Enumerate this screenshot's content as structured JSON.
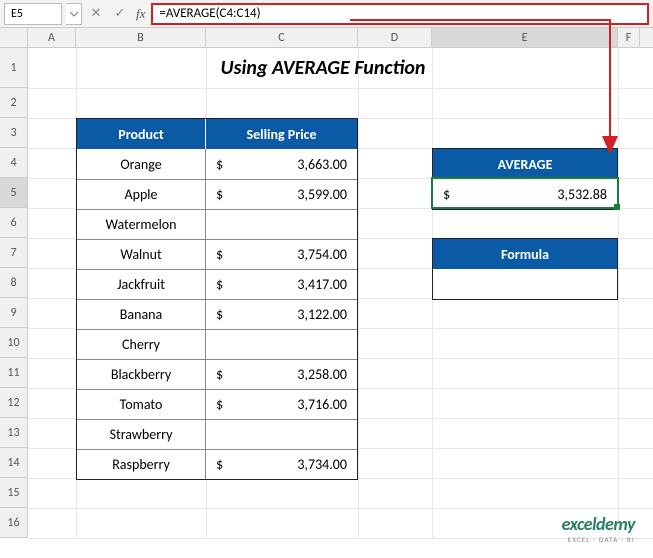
{
  "namebox": "E5",
  "formula": "=AVERAGE(C4:C14)",
  "title": "Using AVERAGE Function",
  "columns": [
    "A",
    "B",
    "C",
    "D",
    "E",
    "F"
  ],
  "rownums": [
    "1",
    "2",
    "3",
    "4",
    "5",
    "6",
    "7",
    "8",
    "9",
    "10",
    "11",
    "12",
    "13",
    "14",
    "15",
    "16"
  ],
  "table": {
    "header_product": "Product",
    "header_price": "Selling Price",
    "rows": [
      {
        "product": "Orange",
        "currency": "$",
        "price": "3,663.00"
      },
      {
        "product": "Apple",
        "currency": "$",
        "price": "3,599.00"
      },
      {
        "product": "Watermelon",
        "currency": "",
        "price": ""
      },
      {
        "product": "Walnut",
        "currency": "$",
        "price": "3,754.00"
      },
      {
        "product": "Jackfruit",
        "currency": "$",
        "price": "3,417.00"
      },
      {
        "product": "Banana",
        "currency": "$",
        "price": "3,122.00"
      },
      {
        "product": "Cherry",
        "currency": "",
        "price": ""
      },
      {
        "product": "Blackberry",
        "currency": "$",
        "price": "3,258.00"
      },
      {
        "product": "Tomato",
        "currency": "$",
        "price": "3,716.00"
      },
      {
        "product": "Strawberry",
        "currency": "",
        "price": ""
      },
      {
        "product": "Raspberry",
        "currency": "$",
        "price": "3,734.00"
      }
    ]
  },
  "average": {
    "label": "AVERAGE",
    "currency": "$",
    "value": "3,532.88"
  },
  "formula_label": "Formula",
  "logo": {
    "main": "exceldemy",
    "sub": "EXCEL · DATA · BI"
  }
}
